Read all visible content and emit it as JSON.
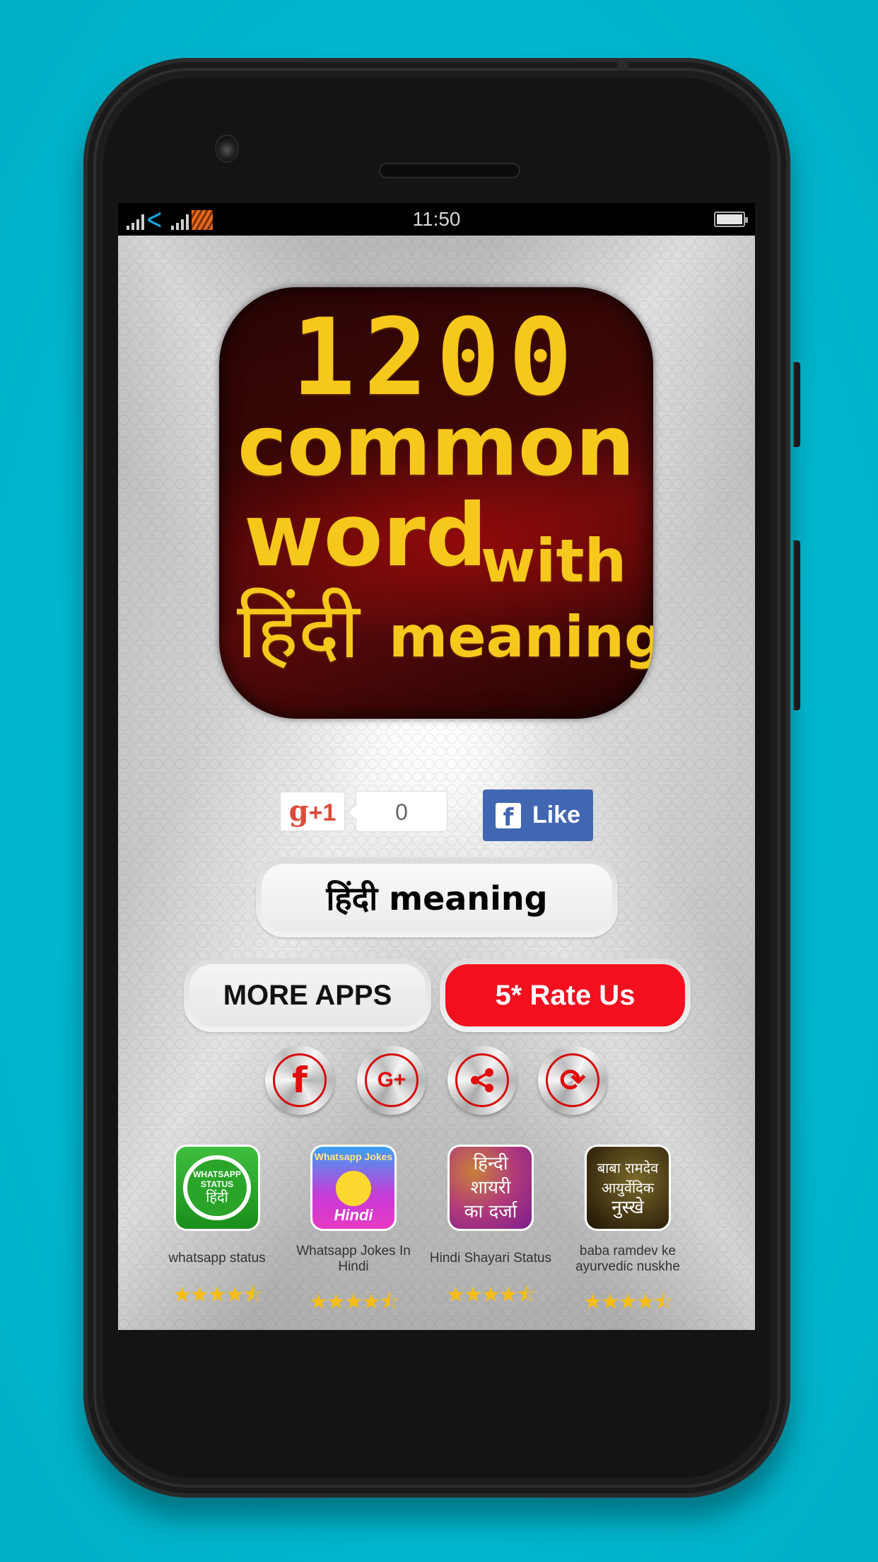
{
  "status_bar": {
    "time": "11:50",
    "signal_icon": "signal-bars-icon",
    "carrier_icon": "telenor-carrier-icon",
    "sim2_icon": "sim2-carrier-icon",
    "battery_icon": "battery-icon"
  },
  "header": {
    "logo": {
      "line1": "1200",
      "line2": "common",
      "line3": "word",
      "line3b": "with",
      "line4": "हिंदी",
      "line4b": "meaning"
    }
  },
  "social": {
    "gplus_label": "g",
    "gplus_suffix": "+1",
    "gplus_count": "0",
    "fb_icon": "f",
    "fb_label": "Like"
  },
  "buttons": {
    "hindi_meaning": "हिंदी meaning",
    "more_apps": "MORE APPS",
    "rate_us": "5* Rate Us"
  },
  "share_icons": [
    {
      "name": "facebook",
      "glyph": "f"
    },
    {
      "name": "google-plus",
      "glyph": "G+"
    },
    {
      "name": "share",
      "glyph": "<"
    },
    {
      "name": "refresh",
      "glyph": "⟳"
    }
  ],
  "colors": {
    "background": "#00b8cf",
    "rate_button": "#f20f1e",
    "facebook_blue": "#4267b2",
    "icon_red": "#e00d0d",
    "star_yellow": "#f7bd12"
  },
  "more_apps": [
    {
      "name": "whatsapp status",
      "icon_text_1": "WHATSAPP",
      "icon_text_2": "STATUS",
      "icon_text_3": "हिंदी",
      "rating": 4.5,
      "stars": "★★★★⯪"
    },
    {
      "name": "Whatsapp Jokes In Hindi",
      "icon_text_1": "Whatsapp Jokes",
      "icon_text_2": "Hindi",
      "rating": 4.5,
      "stars": "★★★★⯪"
    },
    {
      "name": "Hindi Shayari Status",
      "icon_text_1": "हिन्दी",
      "icon_text_2": "शायरी",
      "icon_text_3": "का दर्जा",
      "rating": 4.5,
      "stars": "★★★★⯪"
    },
    {
      "name": "baba ramdev ke ayurvedic nuskhe",
      "icon_text_1": "बाबा रामदेव",
      "icon_text_2": "आयुर्वेदिक",
      "icon_text_3": "नुस्खे",
      "rating": 4.5,
      "stars": "★★★★⯪"
    }
  ]
}
